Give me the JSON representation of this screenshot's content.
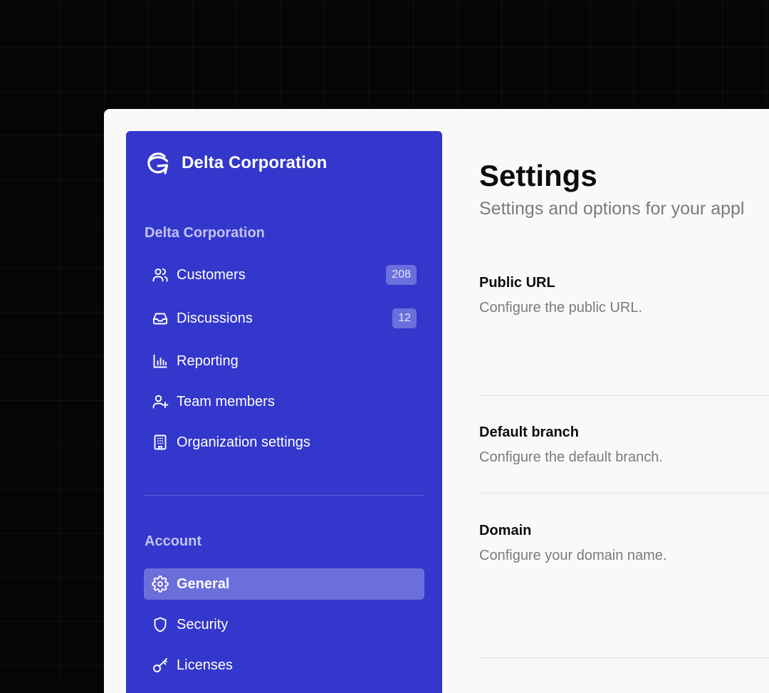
{
  "sidebar": {
    "brand_name": "Delta Corporation",
    "org_section_title": "Delta Corporation",
    "org_items": [
      {
        "label": "Customers",
        "icon": "users-icon",
        "badge": "208"
      },
      {
        "label": "Discussions",
        "icon": "inbox-icon",
        "badge": "12"
      },
      {
        "label": "Reporting",
        "icon": "bar-chart-icon"
      },
      {
        "label": "Team members",
        "icon": "user-plus-icon"
      },
      {
        "label": "Organization settings",
        "icon": "building-icon"
      }
    ],
    "account_section_title": "Account",
    "account_items": [
      {
        "label": "General",
        "icon": "gear-icon",
        "active": true
      },
      {
        "label": "Security",
        "icon": "shield-icon"
      },
      {
        "label": "Licenses",
        "icon": "key-icon"
      }
    ]
  },
  "main": {
    "title": "Settings",
    "subtitle": "Settings and options for your appl",
    "settings": [
      {
        "title": "Public URL",
        "description": "Configure the public URL."
      },
      {
        "title": "Default branch",
        "description": "Configure the default branch."
      },
      {
        "title": "Domain",
        "description": "Configure your domain name."
      }
    ]
  },
  "colors": {
    "sidebar_bg": "#3337cc",
    "active_item_bg": "#6b6fdb",
    "section_title": "#c0c3f5",
    "page_bg": "#f9f9f9"
  }
}
